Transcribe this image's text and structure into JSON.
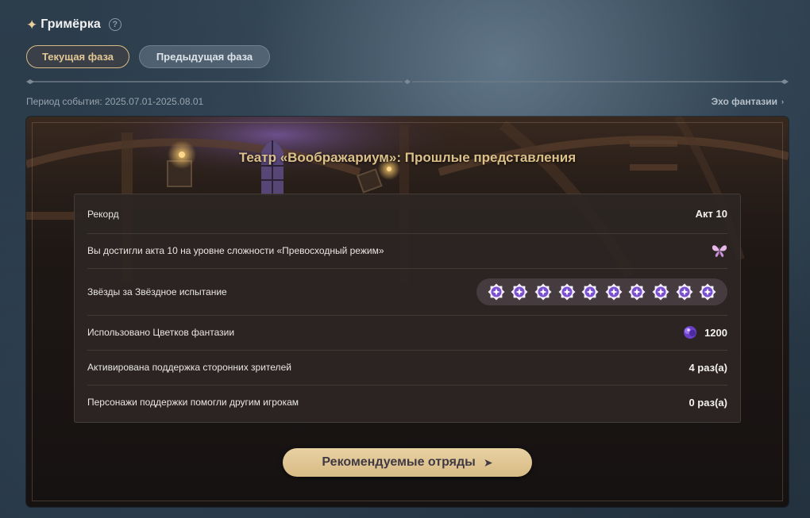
{
  "header": {
    "title": "Гримёрка",
    "sparkle_icon": "sparkle-icon",
    "help_icon": "help-icon",
    "help_glyph": "?"
  },
  "tabs": [
    {
      "label": "Текущая фаза",
      "active": true
    },
    {
      "label": "Предыдущая фаза",
      "active": false
    }
  ],
  "period": {
    "text": "Период события: 2025.07.01-2025.08.01"
  },
  "echo_link": {
    "label": "Эхо фантазии",
    "chevron": "›"
  },
  "panel": {
    "title": "Театр «Воображариум»: Прошлые представления"
  },
  "stats": {
    "record": {
      "label": "Рекорд",
      "value": "Акт 10"
    },
    "difficulty": {
      "label": "Вы достигли акта 10 на уровне сложности «Превосходный режим»",
      "icon": "butterfly-icon"
    },
    "stars": {
      "label": "Звёзды за Звёздное испытание",
      "count": 10,
      "icon": "star-medal-icon"
    },
    "flowers": {
      "label": "Использовано Цветков фантазии",
      "value": "1200",
      "icon": "fantasia-flower-icon"
    },
    "support_activated": {
      "label": "Активирована поддержка сторонних зрителей",
      "value": "4 раз(а)"
    },
    "support_helped": {
      "label": "Персонажи поддержки помогли другим игрокам",
      "value": "0 раз(а)"
    }
  },
  "button": {
    "label": "Рекомендуемые отряды",
    "arrow": "➤"
  },
  "colors": {
    "accent_gold": "#dcc089",
    "tab_border": "#d6bb85",
    "button_bg": "#e3c894",
    "star_purple": "#7a4fd0"
  }
}
